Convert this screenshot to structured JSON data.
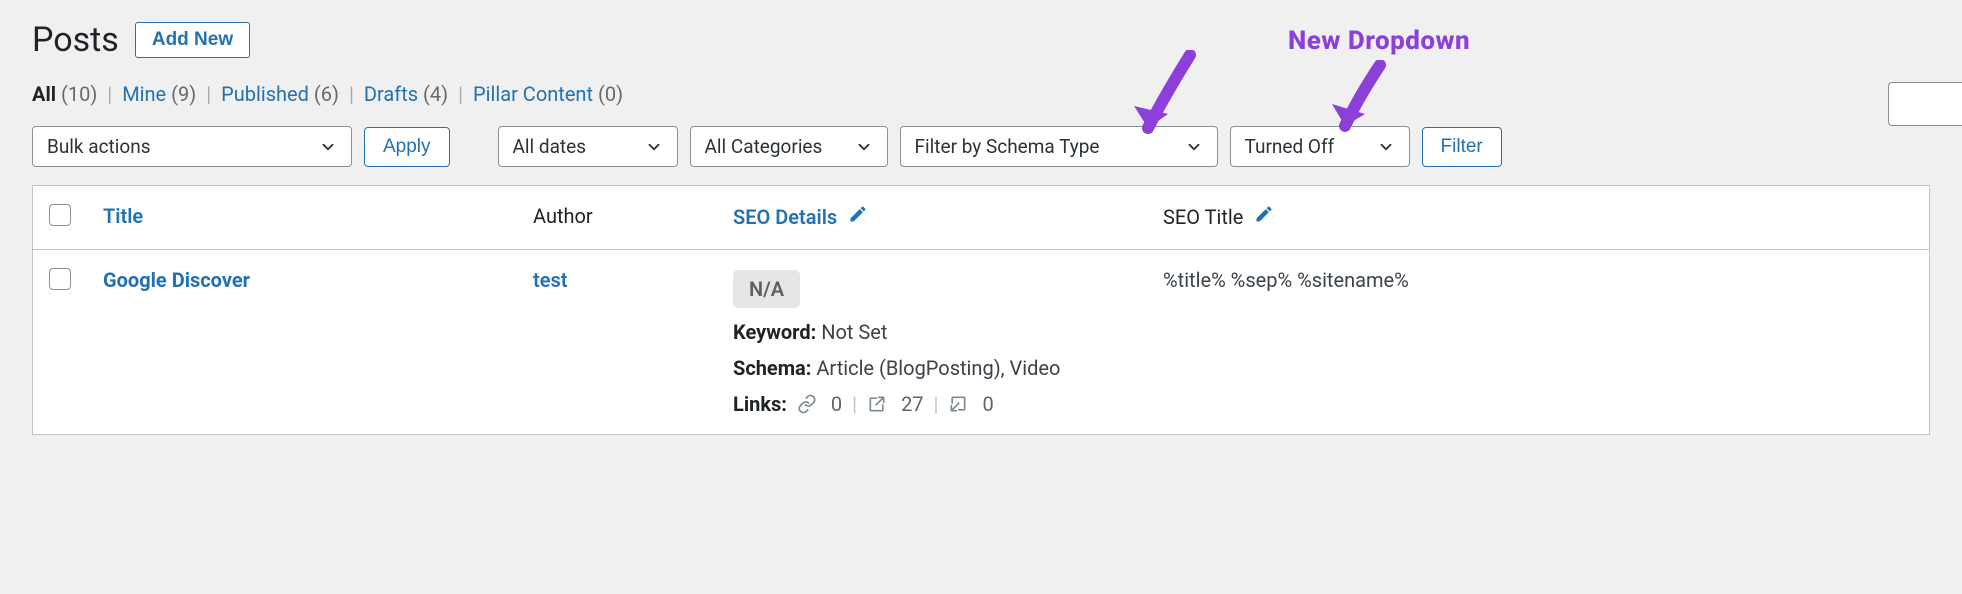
{
  "page": {
    "title": "Posts",
    "add_new": "Add New"
  },
  "views": {
    "all": {
      "label": "All",
      "count": "(10)"
    },
    "mine": {
      "label": "Mine",
      "count": "(9)"
    },
    "published": {
      "label": "Published",
      "count": "(6)"
    },
    "drafts": {
      "label": "Drafts",
      "count": "(4)"
    },
    "pillar": {
      "label": "Pillar Content",
      "count": "(0)"
    }
  },
  "filters": {
    "bulk": "Bulk actions",
    "apply": "Apply",
    "dates": "All dates",
    "categories": "All Categories",
    "schema": "Filter by Schema Type",
    "turned_off": "Turned Off",
    "filter_btn": "Filter"
  },
  "columns": {
    "title": "Title",
    "author": "Author",
    "seo_details": "SEO Details",
    "seo_title": "SEO Title"
  },
  "rows": [
    {
      "title": "Google Discover",
      "author": "test",
      "seo_badge": "N/A",
      "keyword_label": "Keyword:",
      "keyword_value": "Not Set",
      "schema_label": "Schema:",
      "schema_value": "Article (BlogPosting), Video",
      "links_label": "Links:",
      "links_internal": "0",
      "links_external": "27",
      "links_incoming": "0",
      "seo_title": "%title% %sep% %sitename%"
    }
  ],
  "annotation": {
    "label": "New Dropdown"
  }
}
